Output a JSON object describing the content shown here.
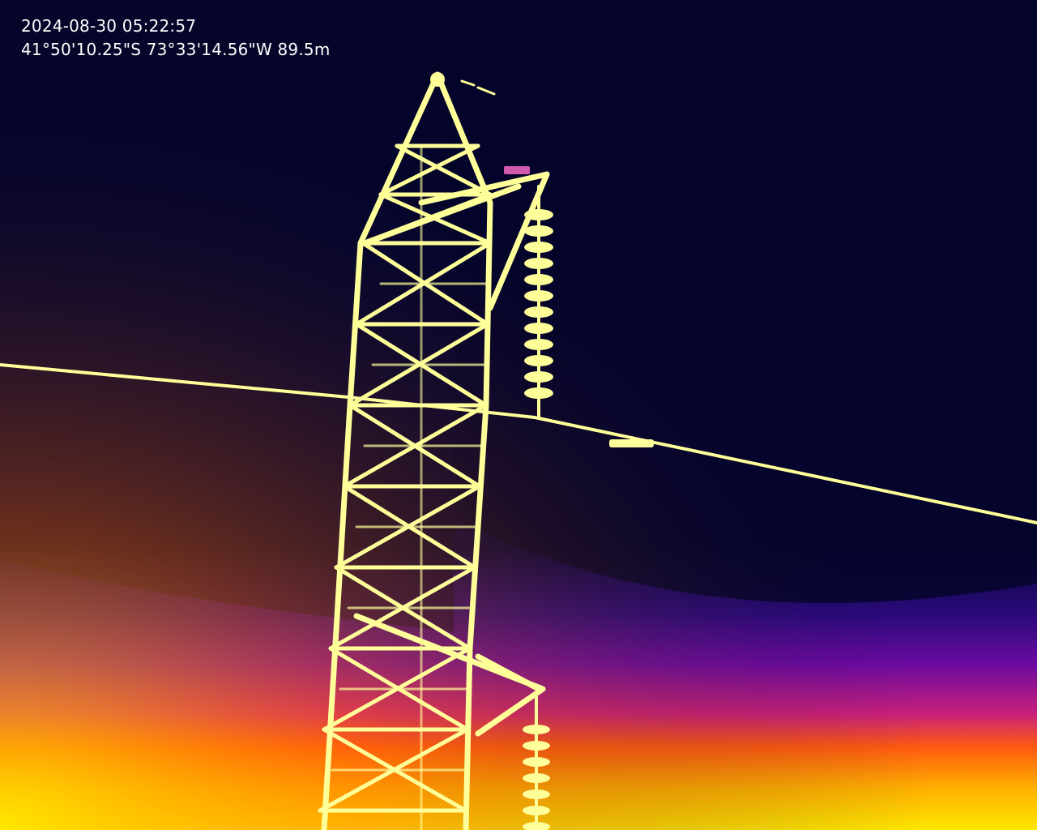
{
  "overlay": {
    "timestamp": "2024-08-30 05:22:57",
    "gps": "41°50'10.25\"S 73°33'14.56\"W 89.5m"
  },
  "palette": {
    "sky": "#05052a",
    "structure": "#ffff9a",
    "mid_purple": "#6a0aa0",
    "hot_orange": "#ff6a00",
    "hot_yellow": "#ffe800"
  }
}
